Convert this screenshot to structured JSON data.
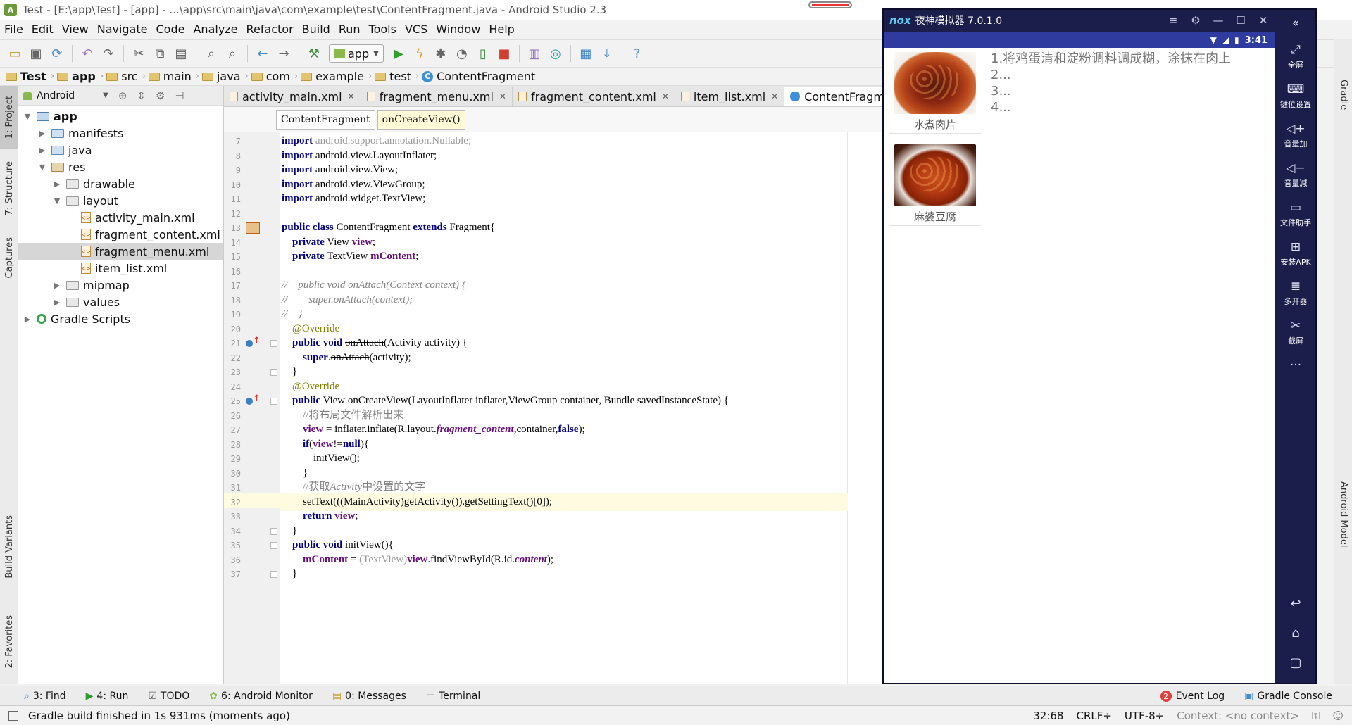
{
  "window": {
    "title": "Test - [E:\\app\\Test] - [app] - ...\\app\\src\\main\\java\\com\\example\\test\\ContentFragment.java - Android Studio 2.3"
  },
  "menu": [
    "File",
    "Edit",
    "View",
    "Navigate",
    "Code",
    "Analyze",
    "Refactor",
    "Build",
    "Run",
    "Tools",
    "VCS",
    "Window",
    "Help"
  ],
  "toolbar": {
    "run_config": "app"
  },
  "breadcrumbs": [
    "Test",
    "app",
    "src",
    "main",
    "java",
    "com",
    "example",
    "test",
    "ContentFragment"
  ],
  "left_strip": {
    "project": "1: Project",
    "structure": "7: Structure",
    "captures": "Captures",
    "build_variants": "Build Variants",
    "favorites": "2: Favorites"
  },
  "right_strip": {
    "gradle": "Gradle",
    "android_model": "Android Model"
  },
  "project_panel": {
    "view_mode": "Android",
    "tree": [
      {
        "label": "app",
        "level": 0,
        "icon": "app-module",
        "arrow": "▼",
        "bold": true
      },
      {
        "label": "manifests",
        "level": 1,
        "icon": "folder-blue",
        "arrow": "▶"
      },
      {
        "label": "java",
        "level": 1,
        "icon": "folder-blue",
        "arrow": "▶"
      },
      {
        "label": "res",
        "level": 1,
        "icon": "folder-res",
        "arrow": "▼"
      },
      {
        "label": "drawable",
        "level": 2,
        "icon": "folder-plain",
        "arrow": "▶"
      },
      {
        "label": "layout",
        "level": 2,
        "icon": "folder-plain",
        "arrow": "▼"
      },
      {
        "label": "activity_main.xml",
        "level": 3,
        "icon": "xml-file",
        "arrow": ""
      },
      {
        "label": "fragment_content.xml",
        "level": 3,
        "icon": "xml-file",
        "arrow": ""
      },
      {
        "label": "fragment_menu.xml",
        "level": 3,
        "icon": "xml-file",
        "arrow": "",
        "selected": true
      },
      {
        "label": "item_list.xml",
        "level": 3,
        "icon": "xml-file",
        "arrow": ""
      },
      {
        "label": "mipmap",
        "level": 2,
        "icon": "folder-plain",
        "arrow": "▶"
      },
      {
        "label": "values",
        "level": 2,
        "icon": "folder-plain",
        "arrow": "▶"
      },
      {
        "label": "Gradle Scripts",
        "level": 0,
        "icon": "gradle",
        "arrow": "▶"
      }
    ]
  },
  "editor_tabs": [
    {
      "label": "activity_main.xml",
      "kind": "xml"
    },
    {
      "label": "fragment_menu.xml",
      "kind": "xml"
    },
    {
      "label": "fragment_content.xml",
      "kind": "xml"
    },
    {
      "label": "item_list.xml",
      "kind": "xml"
    },
    {
      "label": "ContentFragment.java",
      "kind": "class",
      "active": true
    }
  ],
  "editor_subtabs": [
    "ContentFragment",
    "onCreateView()"
  ],
  "code": {
    "line_numbers": [
      7,
      8,
      9,
      10,
      11,
      12,
      13,
      14,
      15,
      16,
      17,
      18,
      19,
      20,
      21,
      22,
      23,
      24,
      25,
      26,
      27,
      28,
      29,
      30,
      31,
      32,
      33,
      34,
      35,
      36,
      37
    ],
    "current_line": 32,
    "lines": [
      {
        "no": 7,
        "segs": [
          [
            "kw",
            "import"
          ],
          [
            "grey",
            " android.support.annotation.Nullable;"
          ]
        ]
      },
      {
        "no": 8,
        "segs": [
          [
            "kw",
            "import"
          ],
          [
            "",
            " android.view.LayoutInflater;"
          ]
        ]
      },
      {
        "no": 9,
        "segs": [
          [
            "kw",
            "import"
          ],
          [
            "",
            " android.view.View;"
          ]
        ]
      },
      {
        "no": 10,
        "segs": [
          [
            "kw",
            "import"
          ],
          [
            "",
            " android.view.ViewGroup;"
          ]
        ]
      },
      {
        "no": 11,
        "segs": [
          [
            "kw",
            "import"
          ],
          [
            "",
            " android.widget.TextView;"
          ]
        ]
      },
      {
        "no": 12,
        "segs": []
      },
      {
        "no": 13,
        "segs": [
          [
            "kw",
            "public class"
          ],
          [
            "",
            " ContentFragment "
          ],
          [
            "kw",
            "extends"
          ],
          [
            "",
            " Fragment{"
          ]
        ]
      },
      {
        "no": 14,
        "segs": [
          [
            "",
            "    "
          ],
          [
            "kw",
            "private"
          ],
          [
            "",
            " View "
          ],
          [
            "fld",
            "view"
          ],
          [
            "",
            ";"
          ]
        ]
      },
      {
        "no": 15,
        "segs": [
          [
            "",
            "    "
          ],
          [
            "kw",
            "private"
          ],
          [
            "",
            " TextView "
          ],
          [
            "fld",
            "mContent"
          ],
          [
            "",
            ";"
          ]
        ]
      },
      {
        "no": 16,
        "segs": []
      },
      {
        "no": 17,
        "segs": [
          [
            "cm",
            "//    public void onAttach(Context context) {"
          ]
        ]
      },
      {
        "no": 18,
        "segs": [
          [
            "cm",
            "//        super.onAttach(context);"
          ]
        ]
      },
      {
        "no": 19,
        "segs": [
          [
            "cm",
            "//    }"
          ]
        ]
      },
      {
        "no": 20,
        "segs": [
          [
            "",
            "    "
          ],
          [
            "an",
            "@Override"
          ]
        ]
      },
      {
        "no": 21,
        "segs": [
          [
            "",
            "    "
          ],
          [
            "kw",
            "public void"
          ],
          [
            "",
            " "
          ],
          [
            "strike",
            "onAttach"
          ],
          [
            "",
            "(Activity activity) {"
          ]
        ]
      },
      {
        "no": 22,
        "segs": [
          [
            "",
            "        "
          ],
          [
            "kw",
            "super"
          ],
          [
            "",
            "."
          ],
          [
            "strike",
            "onAttach"
          ],
          [
            "",
            "(activity);"
          ]
        ]
      },
      {
        "no": 23,
        "segs": [
          [
            "",
            "    }"
          ]
        ]
      },
      {
        "no": 24,
        "segs": [
          [
            "",
            "    "
          ],
          [
            "an",
            "@Override"
          ]
        ]
      },
      {
        "no": 25,
        "segs": [
          [
            "",
            "    "
          ],
          [
            "kw",
            "public"
          ],
          [
            "",
            " View onCreateView(LayoutInflater inflater,ViewGroup container, Bundle savedInstanceState) {"
          ]
        ]
      },
      {
        "no": 26,
        "segs": [
          [
            "",
            "        "
          ],
          [
            "cmz",
            "//将布局文件解析出来"
          ]
        ]
      },
      {
        "no": 27,
        "segs": [
          [
            "",
            "        "
          ],
          [
            "fld",
            "view"
          ],
          [
            "",
            " = inflater.inflate(R.layout."
          ],
          [
            "fldi",
            "fragment_content"
          ],
          [
            "",
            ",container,"
          ],
          [
            "kw",
            "false"
          ],
          [
            "",
            ");"
          ]
        ]
      },
      {
        "no": 28,
        "segs": [
          [
            "",
            "        "
          ],
          [
            "kw",
            "if"
          ],
          [
            "",
            "("
          ],
          [
            "fld",
            "view"
          ],
          [
            "",
            "!="
          ],
          [
            "kw",
            "null"
          ],
          [
            "",
            "){"
          ]
        ]
      },
      {
        "no": 29,
        "segs": [
          [
            "",
            "            initView();"
          ]
        ]
      },
      {
        "no": 30,
        "segs": [
          [
            "",
            "        }"
          ]
        ]
      },
      {
        "no": 31,
        "segs": [
          [
            "",
            "        "
          ],
          [
            "cmz",
            "//获取"
          ],
          [
            "cm",
            "Activity"
          ],
          [
            "cmz",
            "中设置的文字"
          ]
        ]
      },
      {
        "no": 32,
        "segs": [
          [
            "",
            "        setText(((MainActivity)getActivity()).getSettingText()[0]);"
          ]
        ]
      },
      {
        "no": 33,
        "segs": [
          [
            "",
            "        "
          ],
          [
            "kw",
            "return"
          ],
          [
            "",
            " "
          ],
          [
            "fld",
            "view"
          ],
          [
            "",
            ";"
          ]
        ]
      },
      {
        "no": 34,
        "segs": [
          [
            "",
            "    }"
          ]
        ]
      },
      {
        "no": 35,
        "segs": [
          [
            "",
            "    "
          ],
          [
            "kw",
            "public void"
          ],
          [
            "",
            " initView(){"
          ]
        ]
      },
      {
        "no": 36,
        "segs": [
          [
            "",
            "        "
          ],
          [
            "fld",
            "mContent"
          ],
          [
            "",
            " = "
          ],
          [
            "grey",
            "(TextView)"
          ],
          [
            "fld",
            "view"
          ],
          [
            "",
            ".findViewById(R.id."
          ],
          [
            "fldi",
            "content"
          ],
          [
            "",
            ");"
          ]
        ]
      },
      {
        "no": 37,
        "segs": [
          [
            "",
            "    }"
          ]
        ]
      }
    ]
  },
  "bottom_tools": [
    {
      "num": "3",
      "label": ": Find",
      "icon": "search-icon"
    },
    {
      "num": "4",
      "label": ": Run",
      "icon": "run-icon"
    },
    {
      "num": "",
      "label": "TODO",
      "icon": "todo-icon"
    },
    {
      "num": "6",
      "label": ": Android Monitor",
      "icon": "android-icon"
    },
    {
      "num": "0",
      "label": ": Messages",
      "icon": "messages-icon"
    },
    {
      "num": "",
      "label": "Terminal",
      "icon": "terminal-icon"
    }
  ],
  "bottom_right": {
    "event_log_count": "2",
    "event_log": "Event Log",
    "gradle_console": "Gradle Console"
  },
  "status": {
    "message": "Gradle build finished in 1s 931ms (moments ago)",
    "position": "32:68",
    "line_sep": "CRLF÷",
    "encoding": "UTF-8÷",
    "context": "Context: <no context>"
  },
  "nox": {
    "title": "夜神模拟器 7.0.1.0",
    "time": "3:41",
    "dishes": [
      "水煮肉片",
      "麻婆豆腐"
    ],
    "steps": [
      "1.将鸡蛋清和淀粉调料调成糊，涂抹在肉上",
      "2...",
      "3...",
      "4..."
    ],
    "sidebar": [
      "全屏",
      "键位设置",
      "音量加",
      "音量减",
      "文件助手",
      "安装APK",
      "多开器",
      "截屏"
    ]
  }
}
